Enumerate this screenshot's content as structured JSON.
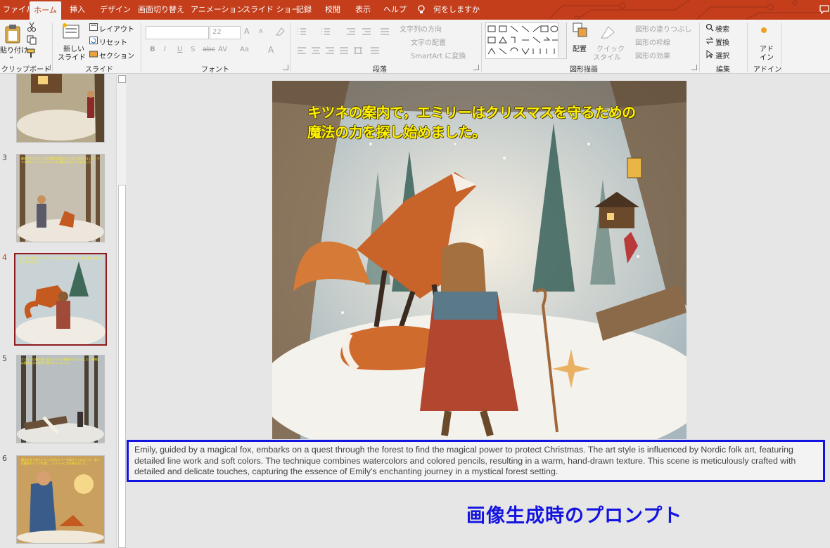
{
  "tabs": [
    {
      "label": "ファイル",
      "active": false
    },
    {
      "label": "ホーム",
      "active": true
    },
    {
      "label": "挿入",
      "active": false
    },
    {
      "label": "デザイン",
      "active": false
    },
    {
      "label": "画面切り替え",
      "active": false
    },
    {
      "label": "アニメーション",
      "active": false
    },
    {
      "label": "スライド ショー",
      "active": false
    },
    {
      "label": "記録",
      "active": false
    },
    {
      "label": "校閲",
      "active": false
    },
    {
      "label": "表示",
      "active": false
    },
    {
      "label": "ヘルプ",
      "active": false
    }
  ],
  "tell_me": "何をしますか",
  "ribbon": {
    "clipboard": {
      "paste": "貼り付け",
      "label": "クリップボード"
    },
    "slides": {
      "new_slide_line1": "新しい",
      "new_slide_line2": "スライド",
      "layout": "レイアウト",
      "reset": "リセット",
      "section": "セクション",
      "label": "スライド"
    },
    "font": {
      "size": "22",
      "label": "フォント",
      "bold": "B",
      "italic": "I",
      "underline": "U",
      "strike": "S",
      "shadow": "abc",
      "spacing": "AV",
      "case": "Aa",
      "color": "A",
      "grow": "A",
      "shrink": "A"
    },
    "paragraph": {
      "text_direction": "文字列の方向",
      "align_text": "文字の配置",
      "smartart": "SmartArt に変換",
      "label": "段落"
    },
    "drawing": {
      "arrange": "配置",
      "quick_styles_line1": "クイック",
      "quick_styles_line2": "スタイル",
      "shape_fill": "図形の塗りつぶし",
      "shape_outline": "図形の枠線",
      "shape_effects": "図形の効果",
      "label": "図形描画"
    },
    "editing": {
      "find": "検索",
      "replace": "置換",
      "select": "選択",
      "label": "編集"
    },
    "addins": {
      "line1": "アド",
      "line2": "イン",
      "label": "アドイン"
    }
  },
  "thumbnails": [
    {
      "number": "",
      "selected": false,
      "caption": ""
    },
    {
      "number": "3",
      "selected": false,
      "caption": "森の中でエミリーは不思議な魔法のキツネに出会いました。キツネはエミリーにクリスマスの魔法を教えてくれました。"
    },
    {
      "number": "4",
      "selected": true,
      "caption": "キツネの案内で，エミリーはクリスマスを守るための魔法の力を探し始めました。"
    },
    {
      "number": "5",
      "selected": false,
      "caption": "エミリーは森の奥に隠された古い巻物を見つけました。巻物には魔法の力の秘密が書かれていました。"
    },
    {
      "number": "6",
      "selected": false,
      "caption": "魔法を使う老人とキツネがエミリーを助けてくれました。老人は魔法のランプを渡し、エミリーに力を授けました。"
    }
  ],
  "slide": {
    "caption_line1": "キツネの案内で，エミリーはクリスマスを守るための",
    "caption_line2": "魔法の力を探し始めました。"
  },
  "notes": "Emily, guided by a magical fox, embarks on a quest through the forest to find the magical power to protect Christmas. The art style is influenced by Nordic folk art, featuring detailed line work and soft colors. The technique combines watercolors and colored pencils, resulting in a warm, hand-drawn texture. This scene is meticulously crafted with detailed and delicate touches, capturing the essence of Emily's enchanting journey in a mystical forest setting.",
  "annotation": "画像生成時のプロンプト",
  "colors": {
    "accent": "#c43e1c",
    "annotation": "#1414e0",
    "caption": "#fff200",
    "thumb_selected": "#8e1a1a"
  }
}
